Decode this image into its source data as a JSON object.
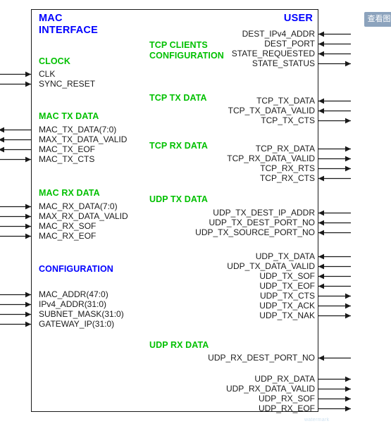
{
  "diagram": {
    "left_corner_title": "MAC\nINTERFACE",
    "right_corner_title": "USER",
    "accent_group_color": "#00c000",
    "accent_title_color": "#0000ff",
    "outline_color": "#1a1a1a"
  },
  "left_groups": [
    {
      "heading": "CLOCK",
      "signals": [
        {
          "name": "CLK",
          "direction": "in"
        },
        {
          "name": "SYNC_RESET",
          "direction": "in"
        }
      ]
    },
    {
      "heading": "MAC TX DATA",
      "signals": [
        {
          "name": "MAC_TX_DATA(7:0)",
          "direction": "out"
        },
        {
          "name": "MAX_TX_DATA_VALID",
          "direction": "out"
        },
        {
          "name": "MAC_TX_EOF",
          "direction": "out"
        },
        {
          "name": "MAC_TX_CTS",
          "direction": "in"
        }
      ]
    },
    {
      "heading": "MAC RX DATA",
      "signals": [
        {
          "name": "MAC_RX_DATA(7:0)",
          "direction": "in"
        },
        {
          "name": "MAX_RX_DATA_VALID",
          "direction": "in"
        },
        {
          "name": "MAC_RX_SOF",
          "direction": "in"
        },
        {
          "name": "MAC_RX_EOF",
          "direction": "in"
        }
      ]
    },
    {
      "heading": "CONFIGURATION",
      "heading_color": "#0000ff",
      "signals": [
        {
          "name": "MAC_ADDR(47:0)",
          "direction": "in"
        },
        {
          "name": "IPv4_ADDR(31:0)",
          "direction": "in"
        },
        {
          "name": "SUBNET_MASK(31:0)",
          "direction": "in"
        },
        {
          "name": "GATEWAY_IP(31:0)",
          "direction": "in"
        }
      ]
    }
  ],
  "right_groups": [
    {
      "heading": "TCP CLIENTS\nCONFIGURATION",
      "signals": [
        {
          "name": "DEST_IPv4_ADDR",
          "direction": "in"
        },
        {
          "name": "DEST_PORT",
          "direction": "in"
        },
        {
          "name": "STATE_REQUESTED",
          "direction": "in"
        },
        {
          "name": "STATE_STATUS",
          "direction": "out"
        }
      ]
    },
    {
      "heading": "TCP TX DATA",
      "signals": [
        {
          "name": "TCP_TX_DATA",
          "direction": "in"
        },
        {
          "name": "TCP_TX_DATA_VALID",
          "direction": "in"
        },
        {
          "name": "TCP_TX_CTS",
          "direction": "out"
        }
      ]
    },
    {
      "heading": "TCP RX DATA",
      "signals": [
        {
          "name": "TCP_RX_DATA",
          "direction": "out"
        },
        {
          "name": "TCP_RX_DATA_VALID",
          "direction": "out"
        },
        {
          "name": "TCP_RX_RTS",
          "direction": "out"
        },
        {
          "name": "TCP_RX_CTS",
          "direction": "in"
        }
      ]
    },
    {
      "heading": "UDP TX DATA",
      "signals": [
        {
          "name": "UDP_TX_DEST_IP_ADDR",
          "direction": "in"
        },
        {
          "name": "UDP_TX_DEST_PORT_NO",
          "direction": "in"
        },
        {
          "name": "UDP_TX_SOURCE_PORT_NO",
          "direction": "in"
        },
        {
          "name": "UDP_TX_DATA",
          "direction": "in"
        },
        {
          "name": "UDP_TX_DATA_VALID",
          "direction": "in"
        },
        {
          "name": "UDP_TX_SOF",
          "direction": "in"
        },
        {
          "name": "UDP_TX_EOF",
          "direction": "in"
        },
        {
          "name": "UDP_TX_CTS",
          "direction": "out"
        },
        {
          "name": "UDP_TX_ACK",
          "direction": "out"
        },
        {
          "name": "UDP_TX_NAK",
          "direction": "out"
        }
      ]
    },
    {
      "heading": "UDP RX DATA",
      "signals": [
        {
          "name": "UDP_RX_DEST_PORT_NO",
          "direction": "in"
        },
        {
          "name": "UDP_RX_DATA",
          "direction": "out"
        },
        {
          "name": "UDP_RX_DATA_VALID",
          "direction": "out"
        },
        {
          "name": "UDP_RX_SOF",
          "direction": "out"
        },
        {
          "name": "UDP_RX_EOF",
          "direction": "out"
        }
      ]
    }
  ],
  "overlay": {
    "corner_button_label": "查看图",
    "footer_watermark": "watermark"
  }
}
